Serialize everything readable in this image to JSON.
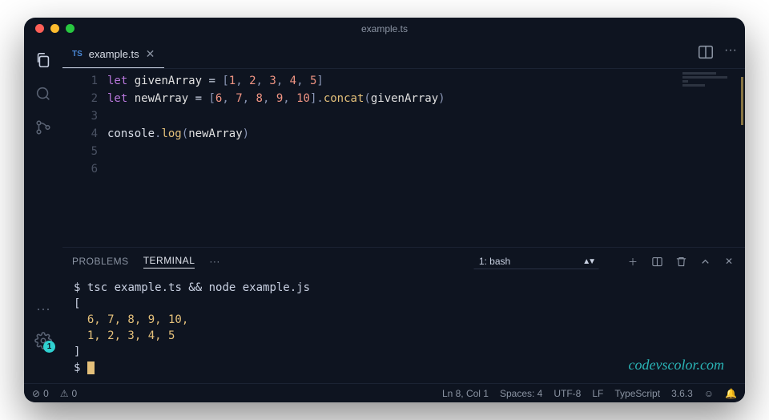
{
  "title": "example.ts",
  "tab": {
    "icon": "TS",
    "label": "example.ts"
  },
  "lines": [
    "1",
    "2",
    "3",
    "4",
    "5",
    "6"
  ],
  "code": {
    "l1": {
      "kw": "let",
      "var": "givenArray",
      "vals": [
        "1",
        "2",
        "3",
        "4",
        "5"
      ]
    },
    "l2": {
      "kw": "let",
      "var": "newArray",
      "vals": [
        "6",
        "7",
        "8",
        "9",
        "10"
      ],
      "fn": "concat",
      "arg": "givenArray"
    },
    "l4": {
      "obj": "console",
      "fn": "log",
      "arg": "newArray"
    }
  },
  "panel": {
    "tabs": {
      "problems": "PROBLEMS",
      "terminal": "TERMINAL",
      "more": "···"
    },
    "select": "1: bash"
  },
  "terminal": {
    "cmd": "tsc example.ts && node example.js",
    "open": "[",
    "row1": "6, 7, 8, 9, 10,",
    "row2": "1, 2, 3, 4,  5",
    "close": "]",
    "prompt": "$"
  },
  "status": {
    "errors": "0",
    "warnings": "0",
    "pos": "Ln 8, Col 1",
    "spaces": "Spaces: 4",
    "encoding": "UTF-8",
    "eol": "LF",
    "lang": "TypeScript",
    "ver": "3.6.3"
  },
  "gear_badge": "1",
  "watermark": "codevscolor.com"
}
